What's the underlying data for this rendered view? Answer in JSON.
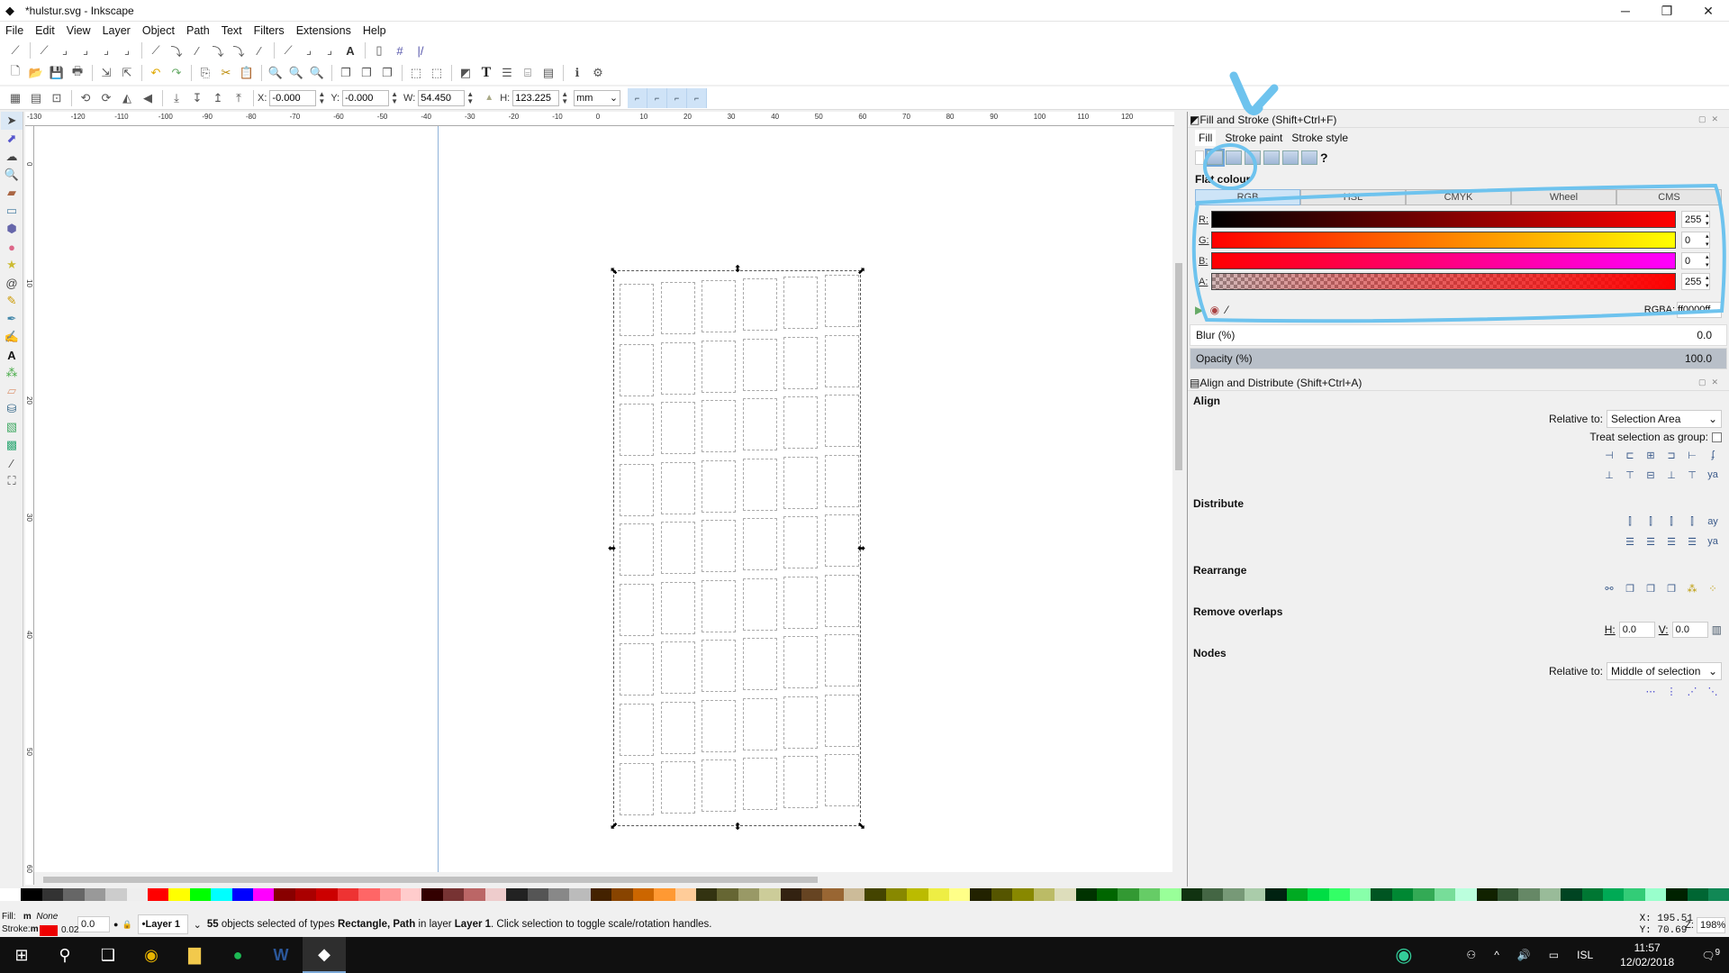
{
  "window": {
    "title": "*hulstur.svg - Inkscape",
    "app_icon": "inkscape-icon"
  },
  "menu": [
    "File",
    "Edit",
    "View",
    "Layer",
    "Object",
    "Path",
    "Text",
    "Filters",
    "Extensions",
    "Help"
  ],
  "toolbar": {
    "x_label": "X:",
    "x_value": "-0.000",
    "y_label": "Y:",
    "y_value": "-0.000",
    "w_label": "W:",
    "w_value": "54.450",
    "h_label": "H:",
    "h_value": "123.225",
    "unit": "mm"
  },
  "ruler": {
    "h_ticks": [
      "-130",
      "-120",
      "-110",
      "-100",
      "-90",
      "-80",
      "-70",
      "-60",
      "-50",
      "-40",
      "-30",
      "-20",
      "-10",
      "0",
      "10",
      "20",
      "30",
      "40",
      "50",
      "60",
      "70",
      "80",
      "90",
      "100",
      "110",
      "120"
    ],
    "v_ticks": [
      "0",
      "10",
      "20",
      "30",
      "40",
      "50",
      "60"
    ]
  },
  "canvas": {
    "rows": 9,
    "cols": 6,
    "selected_count": 55
  },
  "fill_stroke": {
    "title": "Fill and Stroke (Shift+Ctrl+F)",
    "tabs": [
      "Fill",
      "Stroke paint",
      "Stroke style"
    ],
    "mode": "Flat colour",
    "color_tabs": [
      "RGB",
      "HSL",
      "CMYK",
      "Wheel",
      "CMS"
    ],
    "active_color_tab": "RGB",
    "channels": [
      {
        "label": "R:",
        "value": "255"
      },
      {
        "label": "G:",
        "value": "0"
      },
      {
        "label": "B:",
        "value": "0"
      },
      {
        "label": "A:",
        "value": "255"
      }
    ],
    "rgba_label": "RGBA:",
    "rgba_value": "ff0000ff",
    "blur_label": "Blur (%)",
    "blur_value": "0.0",
    "opacity_label": "Opacity (%)",
    "opacity_value": "100.0",
    "color": "#ff0000"
  },
  "align": {
    "title": "Align and Distribute (Shift+Ctrl+A)",
    "align_heading": "Align",
    "relative_label": "Relative to:",
    "relative_value": "Selection Area",
    "treat_group_label": "Treat selection as group:",
    "distribute_heading": "Distribute",
    "rearrange_heading": "Rearrange",
    "remove_overlaps_heading": "Remove overlaps",
    "h_label": "H:",
    "h_value": "0.0",
    "v_label": "V:",
    "v_value": "0.0",
    "nodes_heading": "Nodes",
    "nodes_relative_label": "Relative to:",
    "nodes_relative_value": "Middle of selection"
  },
  "status": {
    "fill_label": "Fill:",
    "fill_value": "None",
    "fill_m": "m",
    "stroke_label": "Stroke:",
    "stroke_m": "m",
    "stroke_width": "0.02",
    "opacity_value": "0.0",
    "layer": "•Layer 1",
    "msg_count": "55",
    "msg_part1": " objects selected of types ",
    "msg_types": "Rectangle, Path",
    "msg_part2": " in layer ",
    "msg_layer": "Layer 1",
    "msg_part3": ". Click selection to toggle scale/rotation handles.",
    "cursor_x": "X: 195.51",
    "cursor_y": "Y:  70.69",
    "zoom_label": "Z:",
    "zoom_value": "198%"
  },
  "taskbar": {
    "apps": [
      "windows-start",
      "search",
      "task-view",
      "chrome",
      "file-explorer",
      "spotify",
      "word",
      "inkscape"
    ],
    "lang": "ISL",
    "time": "11:57",
    "date": "12/02/2018",
    "notifications": "9"
  }
}
